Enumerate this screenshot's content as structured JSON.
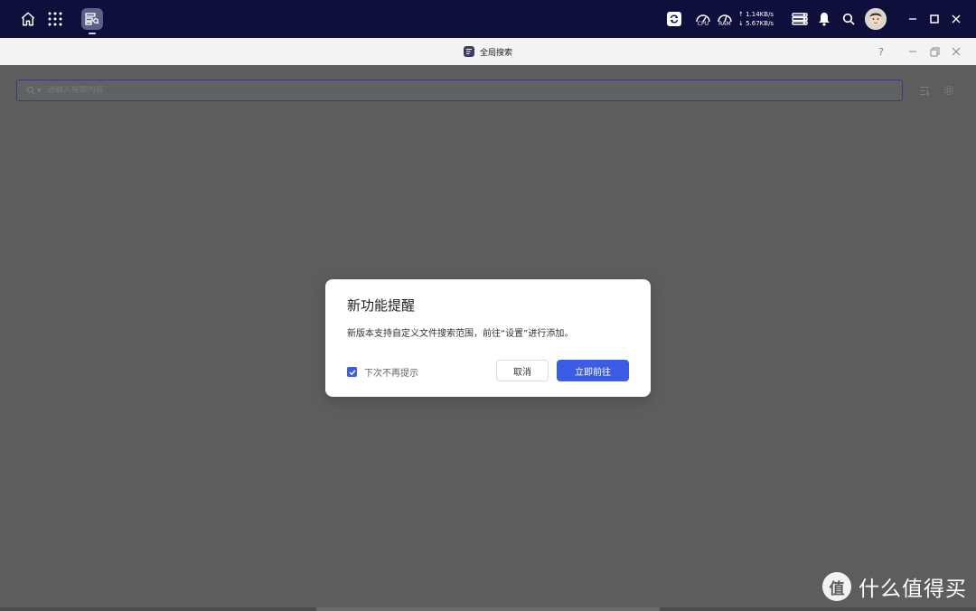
{
  "topbar": {
    "netspeed": {
      "up": "1.14KB/s",
      "down": "5.67KB/s"
    },
    "gauges": {
      "cpu_label": "CPU",
      "ram_label": "RAM"
    },
    "icons": [
      "home-icon",
      "apps-grid-icon",
      "global-search-app-icon",
      "sync-icon",
      "cpu-gauge-icon",
      "ram-gauge-icon",
      "server-list-icon",
      "bell-icon",
      "search-icon",
      "avatar",
      "minimize-icon",
      "maximize-icon",
      "close-icon"
    ]
  },
  "window": {
    "title": "全局搜索",
    "help": "?"
  },
  "search": {
    "placeholder": "请输入搜索内容"
  },
  "dialog": {
    "title": "新功能提醒",
    "message": "新版本支持自定义文件搜索范围，前往“设置”进行添加。",
    "checkbox_label": "下次不再提示",
    "checkbox_checked": true,
    "cancel_label": "取消",
    "confirm_label": "立即前往"
  },
  "watermark": {
    "logo_text": "值",
    "text": "什么值得买"
  },
  "colors": {
    "topbar_bg": "#0e0f3a",
    "accent": "#3d5ce6",
    "overlay": "#5d5d5f"
  }
}
